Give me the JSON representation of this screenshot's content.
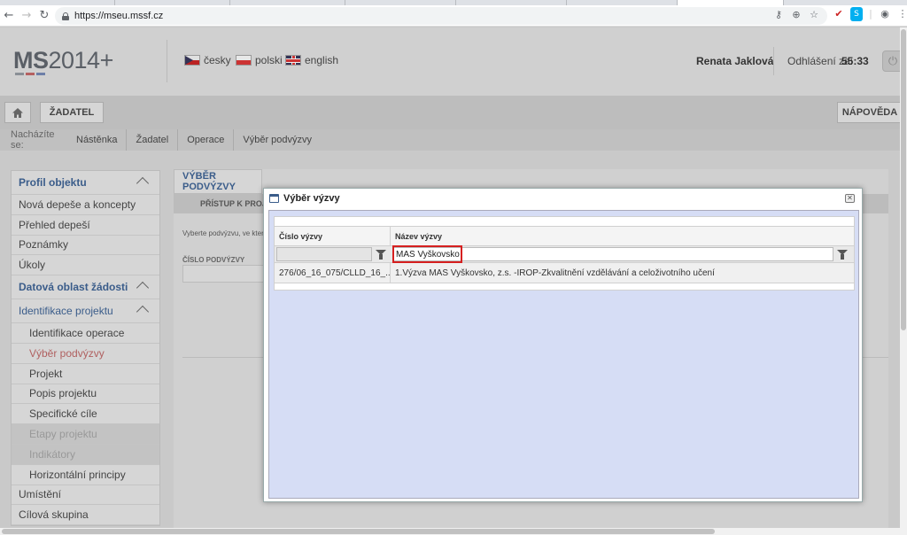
{
  "browser": {
    "url": "https://mseu.mssf.cz"
  },
  "header": {
    "logo_bold": "MS",
    "logo_thin": "2014+",
    "languages": [
      {
        "label": "česky"
      },
      {
        "label": "polski"
      },
      {
        "label": "english"
      }
    ],
    "user_name": "Renata Jaklová",
    "logout_label": "Odhlášení za:",
    "logout_timer": "55:33"
  },
  "menubar": {
    "zadatel_label": "ŽADATEL",
    "help_label": "NÁPOVĚDA"
  },
  "breadcrumb": {
    "prefix": "Nacházíte se:",
    "items": [
      "Nástěnka",
      "Žadatel",
      "Operace",
      "Výběr podvýzvy"
    ]
  },
  "sidebar": {
    "items": [
      {
        "label": "Profil objektu"
      },
      {
        "label": "Nová depeše a koncepty"
      },
      {
        "label": "Přehled depeší"
      },
      {
        "label": "Poznámky"
      },
      {
        "label": "Úkoly"
      },
      {
        "label": "Datová oblast žádosti"
      },
      {
        "label": "Identifikace projektu"
      },
      {
        "label": "Identifikace operace"
      },
      {
        "label": "Výběr podvýzvy"
      },
      {
        "label": "Projekt"
      },
      {
        "label": "Popis projektu"
      },
      {
        "label": "Specifické cíle"
      },
      {
        "label": "Etapy projektu"
      },
      {
        "label": "Indikátory"
      },
      {
        "label": "Horizontální principy"
      },
      {
        "label": "Umístění"
      },
      {
        "label": "Cílová skupina"
      }
    ]
  },
  "content": {
    "title": "VÝBĚR PODVÝZVY",
    "subtitle": "PŘÍSTUP K PROJEKTU",
    "text": "Vyberte podvýzvu, ve které",
    "field_label": "ČÍSLO PODVÝZVY"
  },
  "modal": {
    "title": "Výběr výzvy",
    "columns": [
      "Číslo výzvy",
      "Název výzvy"
    ],
    "filter_cislo": "",
    "filter_nazev": "MAS Vyškovsko",
    "rows": [
      {
        "cislo": "276/06_16_075/CLLD_16_...",
        "nazev": "1.Výzva MAS Vyškovsko, z.s. -IROP-Zkvalitnění vzdělávání a celoživotního učení"
      }
    ]
  },
  "colors": {
    "highlight": "#d62020",
    "section_blue": "#3a5c8a",
    "active_item": "#b06060",
    "modal_body": "#d6ddf5"
  }
}
